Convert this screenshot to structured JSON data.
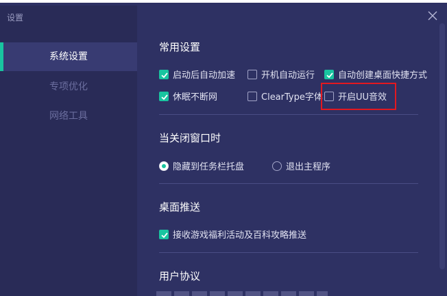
{
  "window": {
    "title": "设置"
  },
  "sidebar": {
    "items": [
      {
        "label": "系统设置",
        "active": true
      },
      {
        "label": "专项优化",
        "active": false
      },
      {
        "label": "网络工具",
        "active": false
      }
    ]
  },
  "sections": {
    "common": {
      "title": "常用设置",
      "options": [
        {
          "label": "启动后自动加速",
          "checked": true
        },
        {
          "label": "开机自动运行",
          "checked": false
        },
        {
          "label": "自动创建桌面快捷方式",
          "checked": true
        },
        {
          "label": "休眠不断网",
          "checked": true
        },
        {
          "label": "ClearType字体",
          "checked": false
        },
        {
          "label": "开启UU音效",
          "checked": false
        }
      ]
    },
    "close_window": {
      "title": "当关闭窗口时",
      "options": [
        {
          "label": "隐藏到任务栏托盘",
          "selected": true
        },
        {
          "label": "退出主程序",
          "selected": false
        }
      ]
    },
    "push": {
      "title": "桌面推送",
      "options": [
        {
          "label": "接收游戏福利活动及百科攻略推送",
          "checked": true
        }
      ]
    },
    "agreement": {
      "title": "用户协议"
    }
  },
  "colors": {
    "accent": "#19c4a0",
    "background": "#2e3163",
    "sidebar": "#292b57",
    "highlight_box": "#e3181f"
  },
  "icons": {
    "close": "close-icon",
    "check": "check-icon"
  }
}
